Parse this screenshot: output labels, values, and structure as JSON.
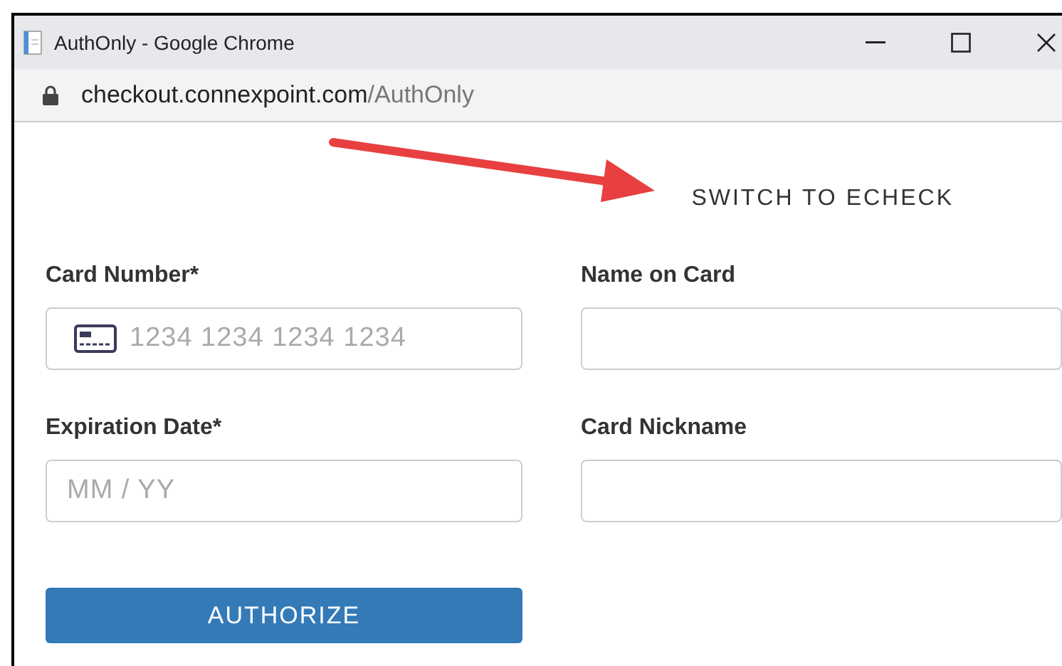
{
  "window": {
    "title": "AuthOnly - Google Chrome"
  },
  "address_bar": {
    "host": "checkout.connexpoint.com",
    "path": "/AuthOnly"
  },
  "switch_link": "SWITCH TO ECHECK",
  "fields": [
    {
      "label": "Card Number*",
      "placeholder": "1234 1234 1234 1234",
      "kind": "card"
    },
    {
      "label": "Name on Card",
      "kind": "text"
    },
    {
      "label": "Expiration Date*",
      "placeholder": "MM / YY",
      "kind": "text"
    },
    {
      "label": "Card Nickname",
      "kind": "text"
    }
  ],
  "button": "AUTHORIZE"
}
